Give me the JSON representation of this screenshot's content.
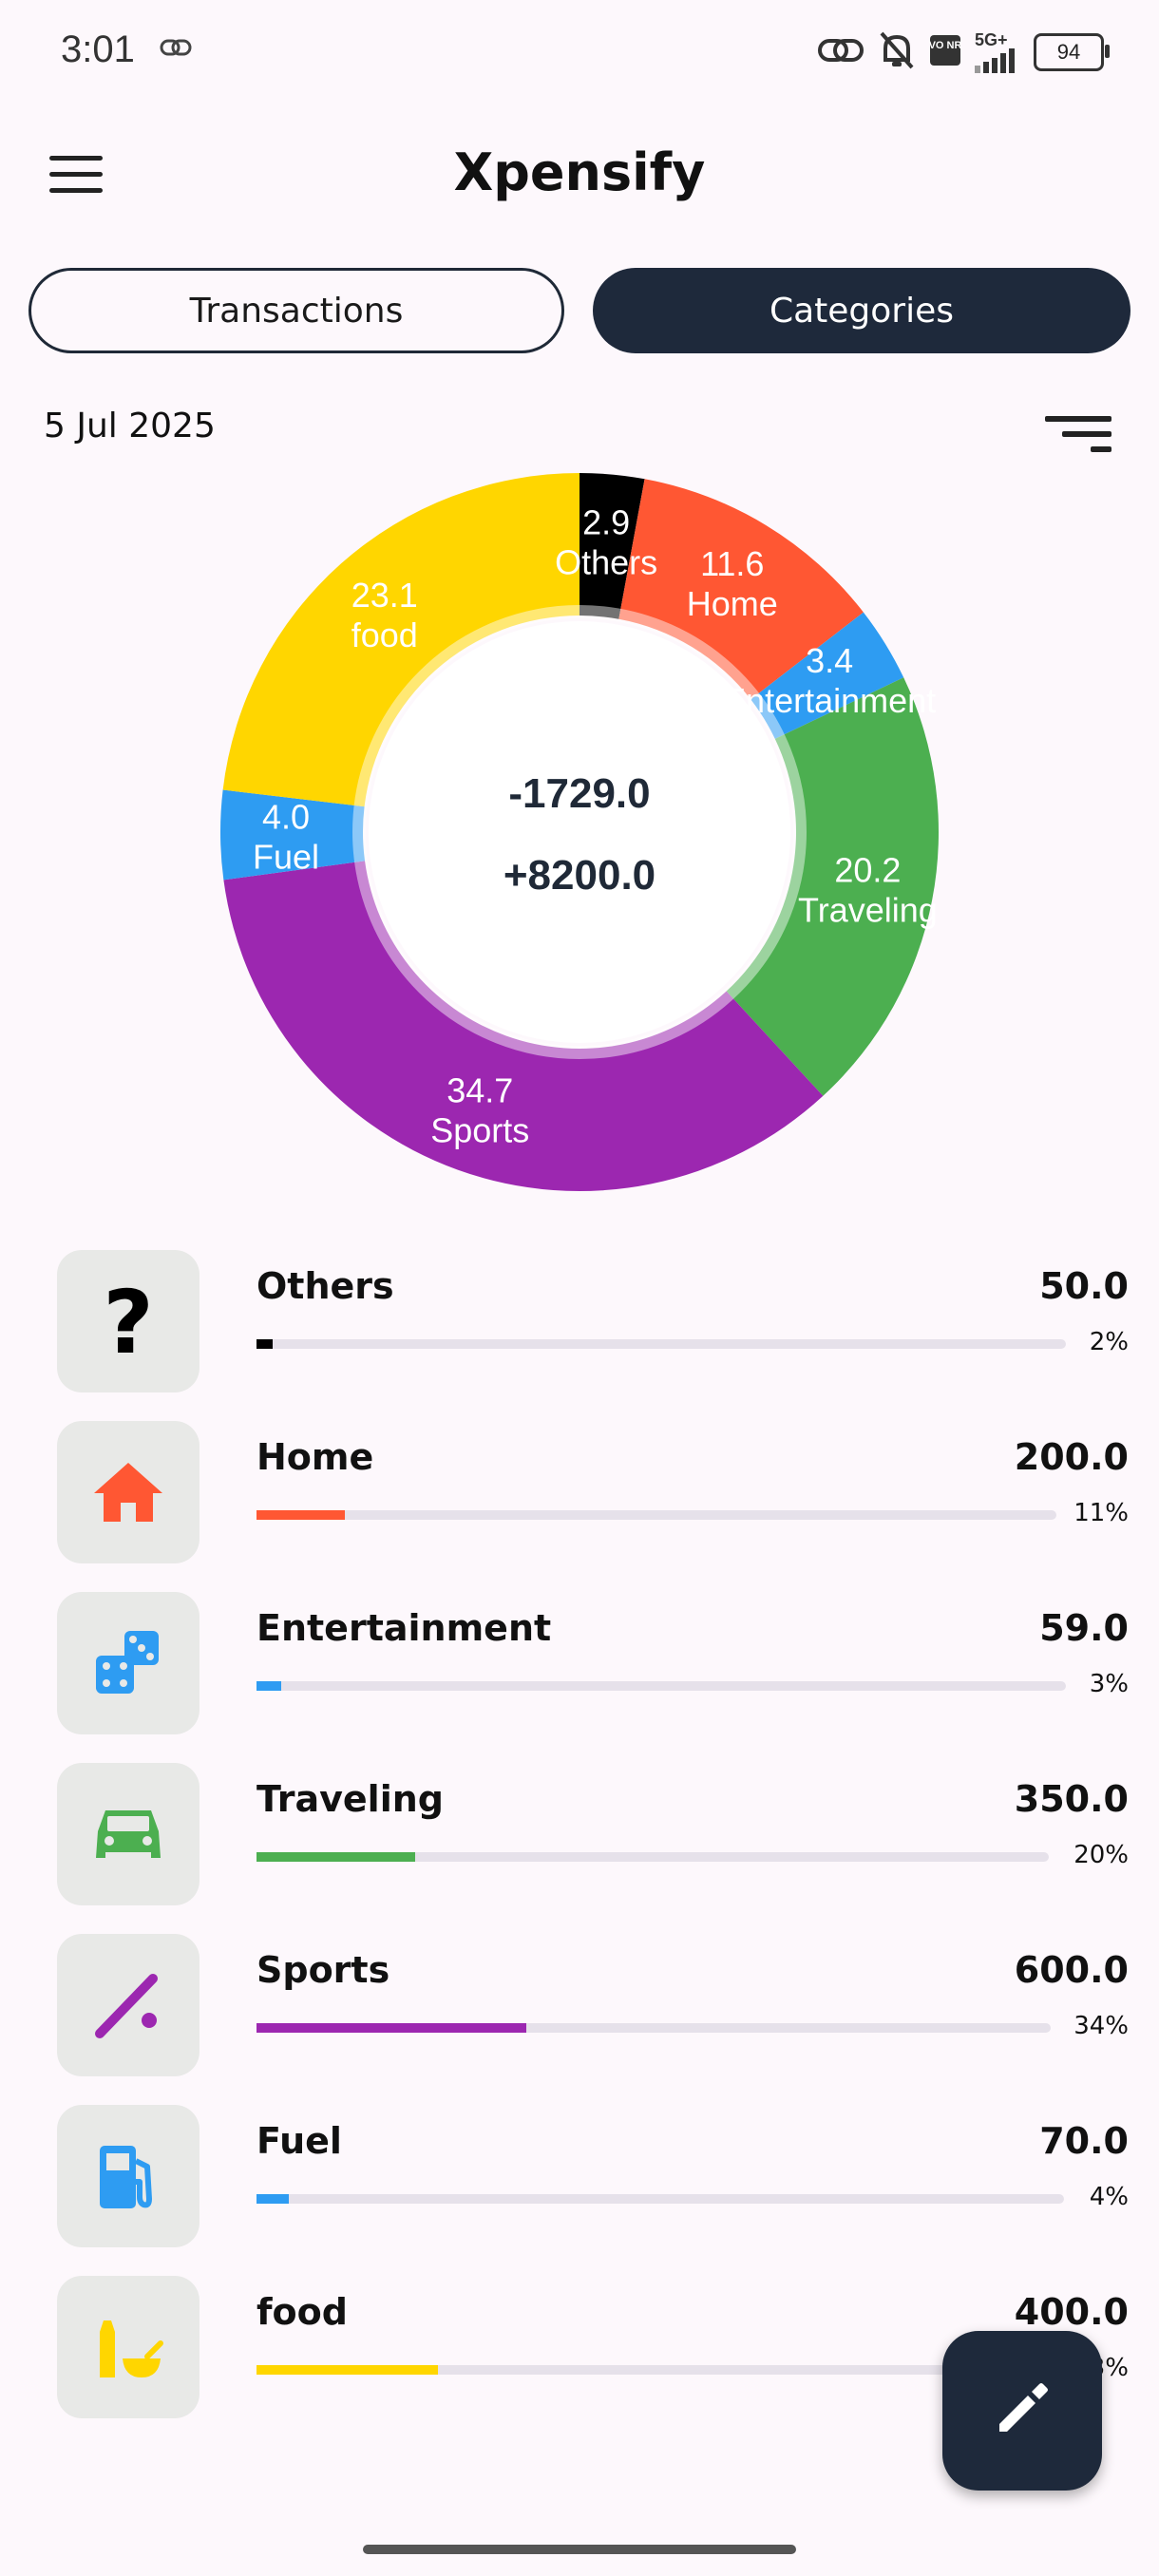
{
  "status_bar": {
    "time": "3:01",
    "network": "5G+",
    "volte": "VO NR",
    "battery": "94"
  },
  "app": {
    "title": "Xpensify"
  },
  "tabs": [
    {
      "label": "Transactions",
      "selected": false
    },
    {
      "label": "Categories",
      "selected": true
    }
  ],
  "date": "5 Jul 2025",
  "donut": {
    "expense_total": "-1729.0",
    "income_total": "+8200.0",
    "slices": [
      {
        "label": "Others",
        "value_label": "2.9",
        "percent": 2.9,
        "color": "#000000"
      },
      {
        "label": "Home",
        "value_label": "11.6",
        "percent": 11.6,
        "color": "#ff5733"
      },
      {
        "label": "Entertainment",
        "value_label": "3.4",
        "percent": 3.4,
        "color": "#2e9cf2"
      },
      {
        "label": "Traveling",
        "value_label": "20.2",
        "percent": 20.2,
        "color": "#4caf50"
      },
      {
        "label": "Sports",
        "value_label": "34.7",
        "percent": 34.7,
        "color": "#9c27b0"
      },
      {
        "label": "Fuel",
        "value_label": "4.0",
        "percent": 4.0,
        "color": "#2e9cf2"
      },
      {
        "label": "food",
        "value_label": "23.1",
        "percent": 23.1,
        "color": "#ffd600"
      }
    ]
  },
  "categories": [
    {
      "name": "Others",
      "amount": "50.0",
      "pct": "2%",
      "fraction": 0.02,
      "color": "#000000",
      "icon": "question-mark-icon"
    },
    {
      "name": "Home",
      "amount": "200.0",
      "pct": "11%",
      "fraction": 0.11,
      "color": "#ff5733",
      "icon": "house-icon"
    },
    {
      "name": "Entertainment",
      "amount": "59.0",
      "pct": "3%",
      "fraction": 0.03,
      "color": "#2e9cf2",
      "icon": "dice-icon"
    },
    {
      "name": "Traveling",
      "amount": "350.0",
      "pct": "20%",
      "fraction": 0.2,
      "color": "#4caf50",
      "icon": "car-icon"
    },
    {
      "name": "Sports",
      "amount": "600.0",
      "pct": "34%",
      "fraction": 0.34,
      "color": "#9c27b0",
      "icon": "baseball-icon"
    },
    {
      "name": "Fuel",
      "amount": "70.0",
      "pct": "4%",
      "fraction": 0.04,
      "color": "#2e9cf2",
      "icon": "fuel-pump-icon"
    },
    {
      "name": "food",
      "amount": "400.0",
      "pct": "23%",
      "fraction": 0.23,
      "color": "#ffd600",
      "icon": "food-icon"
    }
  ]
}
